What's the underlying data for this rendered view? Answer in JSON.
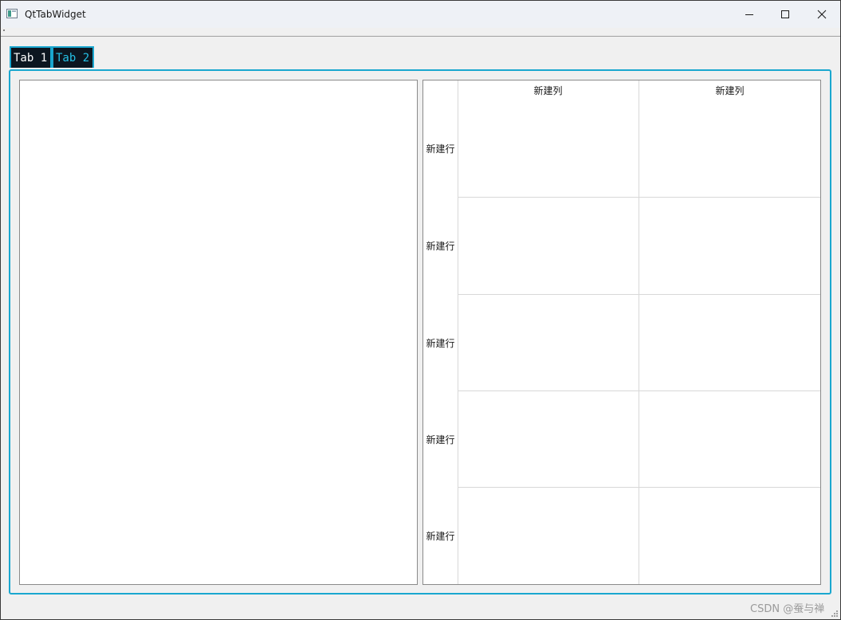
{
  "window": {
    "title": "QtTabWidget"
  },
  "tabs": [
    {
      "label": "Tab 1"
    },
    {
      "label": "Tab 2"
    }
  ],
  "table": {
    "column_headers": [
      "新建列",
      "新建列"
    ],
    "row_headers": [
      "新建行",
      "新建行",
      "新建行",
      "新建行",
      "新建行"
    ]
  },
  "watermark": "CSDN @蚕与禅",
  "colors": {
    "accent": "#1aa7cf",
    "tab_background": "#0c1620",
    "tab_active_text": "#25c1e6"
  }
}
